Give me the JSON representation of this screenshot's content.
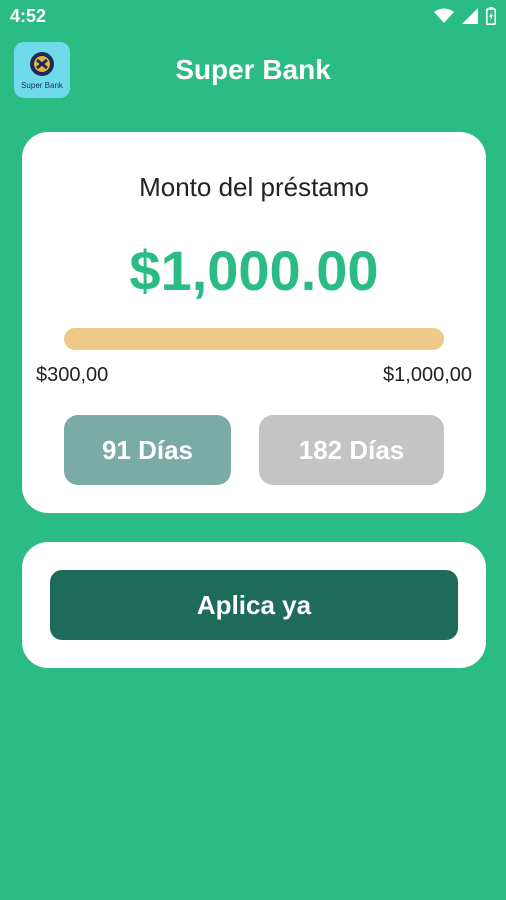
{
  "status_bar": {
    "time": "4:52",
    "icons": [
      "wifi-icon",
      "signal-icon",
      "battery-icon"
    ]
  },
  "header": {
    "title": "Super Bank",
    "logo_text": "Super Bank"
  },
  "loan": {
    "label": "Monto del préstamo",
    "amount": "$1,000.00",
    "slider": {
      "min_label": "$300,00",
      "max_label": "$1,000,00",
      "value_fraction": 1.0
    },
    "terms": [
      {
        "label": "91 Días",
        "selected": true
      },
      {
        "label": "182 Días",
        "selected": false
      }
    ]
  },
  "apply": {
    "label": "Aplica ya"
  },
  "colors": {
    "background": "#2bbb85",
    "amount": "#2bbb85",
    "slider_track": "#efc987",
    "term_selected": "#7aaba4",
    "term_unselected": "#c4c4c4",
    "apply_button": "#1d6b58"
  }
}
